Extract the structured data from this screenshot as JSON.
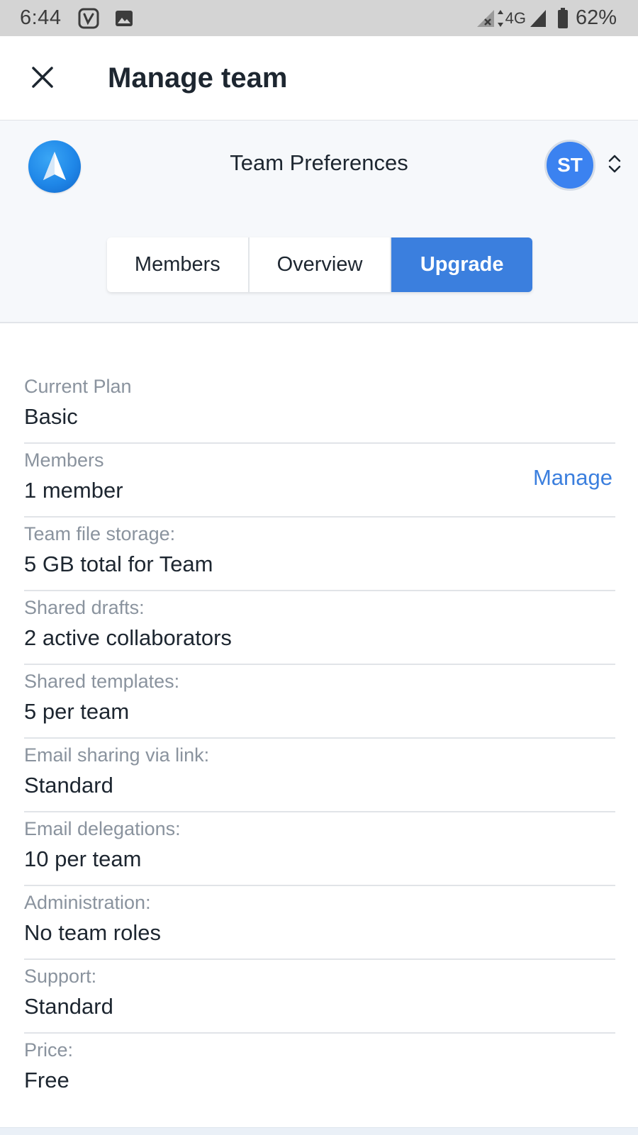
{
  "status_bar": {
    "time": "6:44",
    "network": "4G",
    "battery": "62%",
    "icons": [
      "app-notification-icon",
      "image-notification-icon",
      "signal-no-data-icon",
      "signal-icon",
      "battery-icon"
    ]
  },
  "app_bar": {
    "title": "Manage team",
    "close_icon": "close-icon"
  },
  "header": {
    "section_title": "Team Preferences",
    "avatar_initials": "ST",
    "logo_icon": "paper-plane-logo-icon",
    "switcher_icon": "chevron-up-down-icon"
  },
  "tabs": [
    {
      "label": "Members",
      "active": false
    },
    {
      "label": "Overview",
      "active": false
    },
    {
      "label": "Upgrade",
      "active": true
    }
  ],
  "plan": [
    {
      "label": "Current Plan",
      "value": "Basic"
    },
    {
      "label": "Members",
      "value": "1 member",
      "action": "Manage"
    },
    {
      "label": "Team file storage:",
      "value": "5 GB total for Team"
    },
    {
      "label": "Shared drafts:",
      "value": "2 active collaborators"
    },
    {
      "label": "Shared templates:",
      "value": "5 per team"
    },
    {
      "label": "Email sharing via link:",
      "value": "Standard"
    },
    {
      "label": "Email delegations:",
      "value": "10 per team"
    },
    {
      "label": "Administration:",
      "value": "No team roles"
    },
    {
      "label": "Support:",
      "value": "Standard"
    },
    {
      "label": "Price:",
      "value": "Free"
    }
  ],
  "colors": {
    "accent": "#3b7fde",
    "avatar": "#3b82f0",
    "status_bar": "#d4d4d4",
    "header_bg": "#f6f8fb"
  }
}
